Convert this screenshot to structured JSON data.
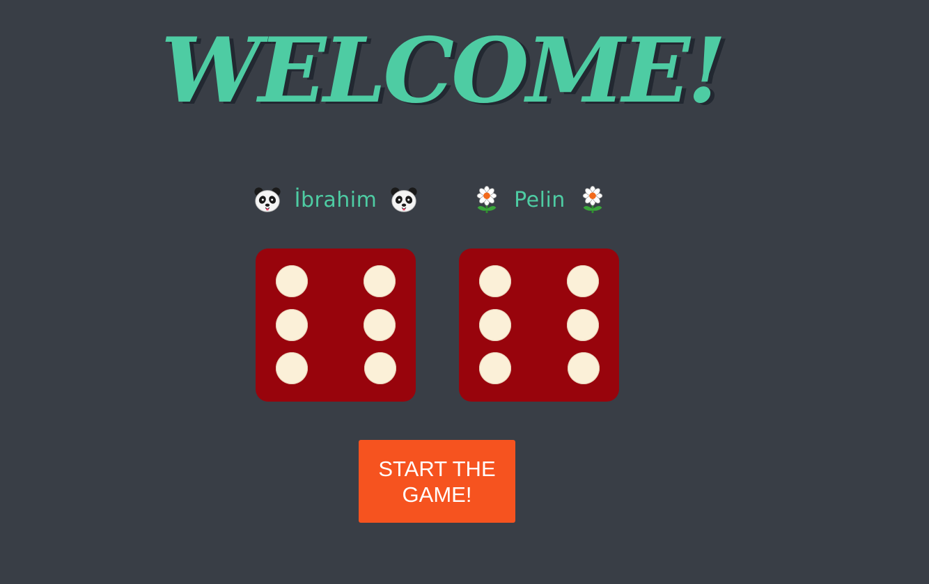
{
  "header": {
    "title": "WELCOME!"
  },
  "players": [
    {
      "name": "İbrahim",
      "icon": "panda-icon"
    },
    {
      "name": "Pelin",
      "icon": "daisy-icon"
    }
  ],
  "dice": [
    {
      "value": 6
    },
    {
      "value": 6
    }
  ],
  "controls": {
    "start_label": "START THE GAME!"
  },
  "colors": {
    "background": "#393e46",
    "accent": "#4ecca3",
    "dice": "#98040c",
    "pip": "#fbf0d8",
    "button": "#f6531f"
  }
}
